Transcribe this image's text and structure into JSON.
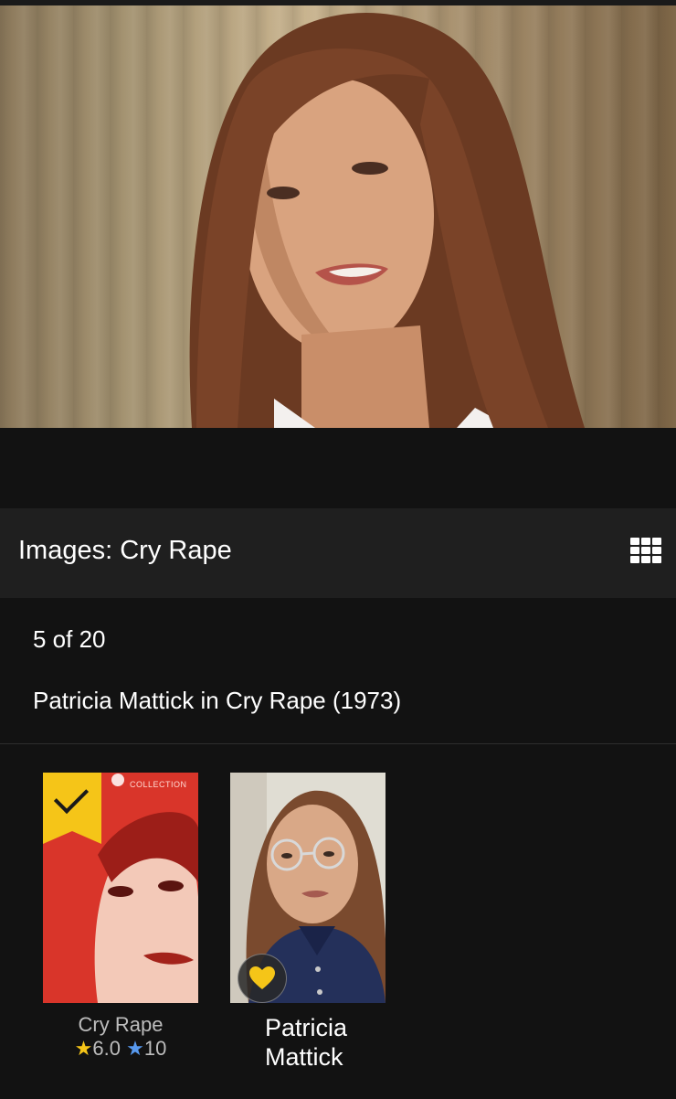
{
  "header": {
    "title": "Images: Cry Rape",
    "grid_icon": "grid-view-icon"
  },
  "viewer": {
    "counter": "5 of 20",
    "caption": "Patricia Mattick in Cry Rape (1973)"
  },
  "related": [
    {
      "title": "Cry Rape",
      "rating": "6.0",
      "user_rating": "10",
      "badge": "watchlist-check-icon",
      "poster_text": "COLLECTION"
    },
    {
      "title_line1": "Patricia",
      "title_line2": "Mattick",
      "badge": "heart-icon"
    }
  ],
  "colors": {
    "accent": "#f5c518",
    "user_rating_star": "#5799ef",
    "background": "#121212",
    "title_bar": "#1f1f1f"
  }
}
